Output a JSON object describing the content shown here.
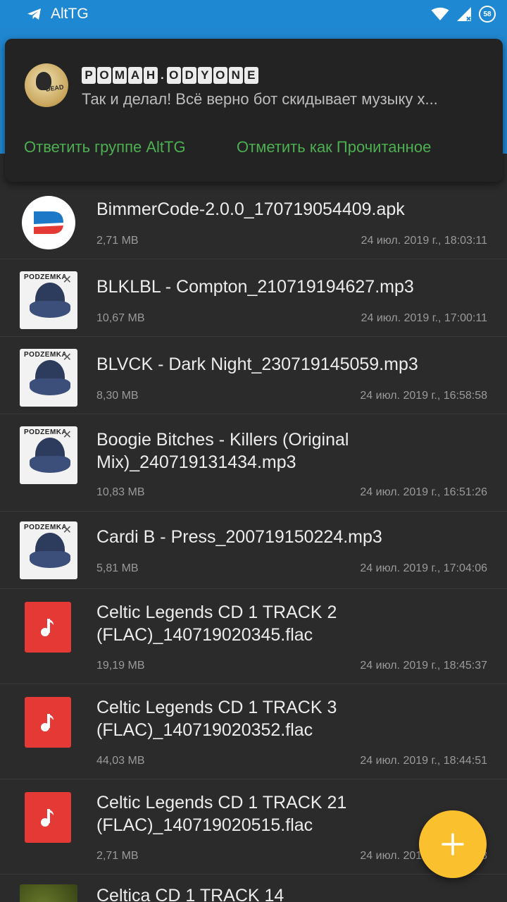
{
  "statusbar": {
    "app_name": "AltTG",
    "battery": "58"
  },
  "notification": {
    "sender_letters": [
      "Р",
      "О",
      "М",
      "А",
      "Н",
      ".",
      "O",
      "D",
      "Y",
      "O",
      "N",
      "E"
    ],
    "message": "Так и делал! Всё верно бот скидывает музыку х...",
    "avatar_text": "DEAD",
    "action_reply": "Ответить группе AltTG",
    "action_read": "Отметить как Прочитанное"
  },
  "files": [
    {
      "name": "BimmerCode-2.0.0_170719054409.apk",
      "size": "2,71 MB",
      "date": "24 июл. 2019 г., 18:03:11",
      "thumb": "app"
    },
    {
      "name": "BLKLBL - Compton_210719194627.mp3",
      "size": "10,67 MB",
      "date": "24 июл. 2019 г., 17:00:11",
      "thumb": "cover"
    },
    {
      "name": "BLVCK - Dark Night_230719145059.mp3",
      "size": "8,30 MB",
      "date": "24 июл. 2019 г., 16:58:58",
      "thumb": "cover"
    },
    {
      "name": "Boogie Bitches - Killers (Original Mix)_240719131434.mp3",
      "size": "10,83 MB",
      "date": "24 июл. 2019 г., 16:51:26",
      "thumb": "cover"
    },
    {
      "name": "Cardi B - Press_200719150224.mp3",
      "size": "5,81 MB",
      "date": "24 июл. 2019 г., 17:04:06",
      "thumb": "cover"
    },
    {
      "name": "Celtic Legends CD 1 TRACK 2 (FLAC)_140719020345.flac",
      "size": "19,19 MB",
      "date": "24 июл. 2019 г., 18:45:37",
      "thumb": "music"
    },
    {
      "name": "Celtic Legends CD 1 TRACK 3 (FLAC)_140719020352.flac",
      "size": "44,03 MB",
      "date": "24 июл. 2019 г., 18:44:51",
      "thumb": "music"
    },
    {
      "name": "Celtic Legends CD 1 TRACK 21 (FLAC)_140719020515.flac",
      "size": "2,71 MB",
      "date": "24 июл. 2019 г., 18:43:58",
      "thumb": "music"
    },
    {
      "name": "Celtica CD 1 TRACK 14",
      "size": "",
      "date": "",
      "thumb": "green"
    }
  ],
  "cover_title": "PODZEMKA",
  "fab": {
    "icon": "plus-icon"
  }
}
